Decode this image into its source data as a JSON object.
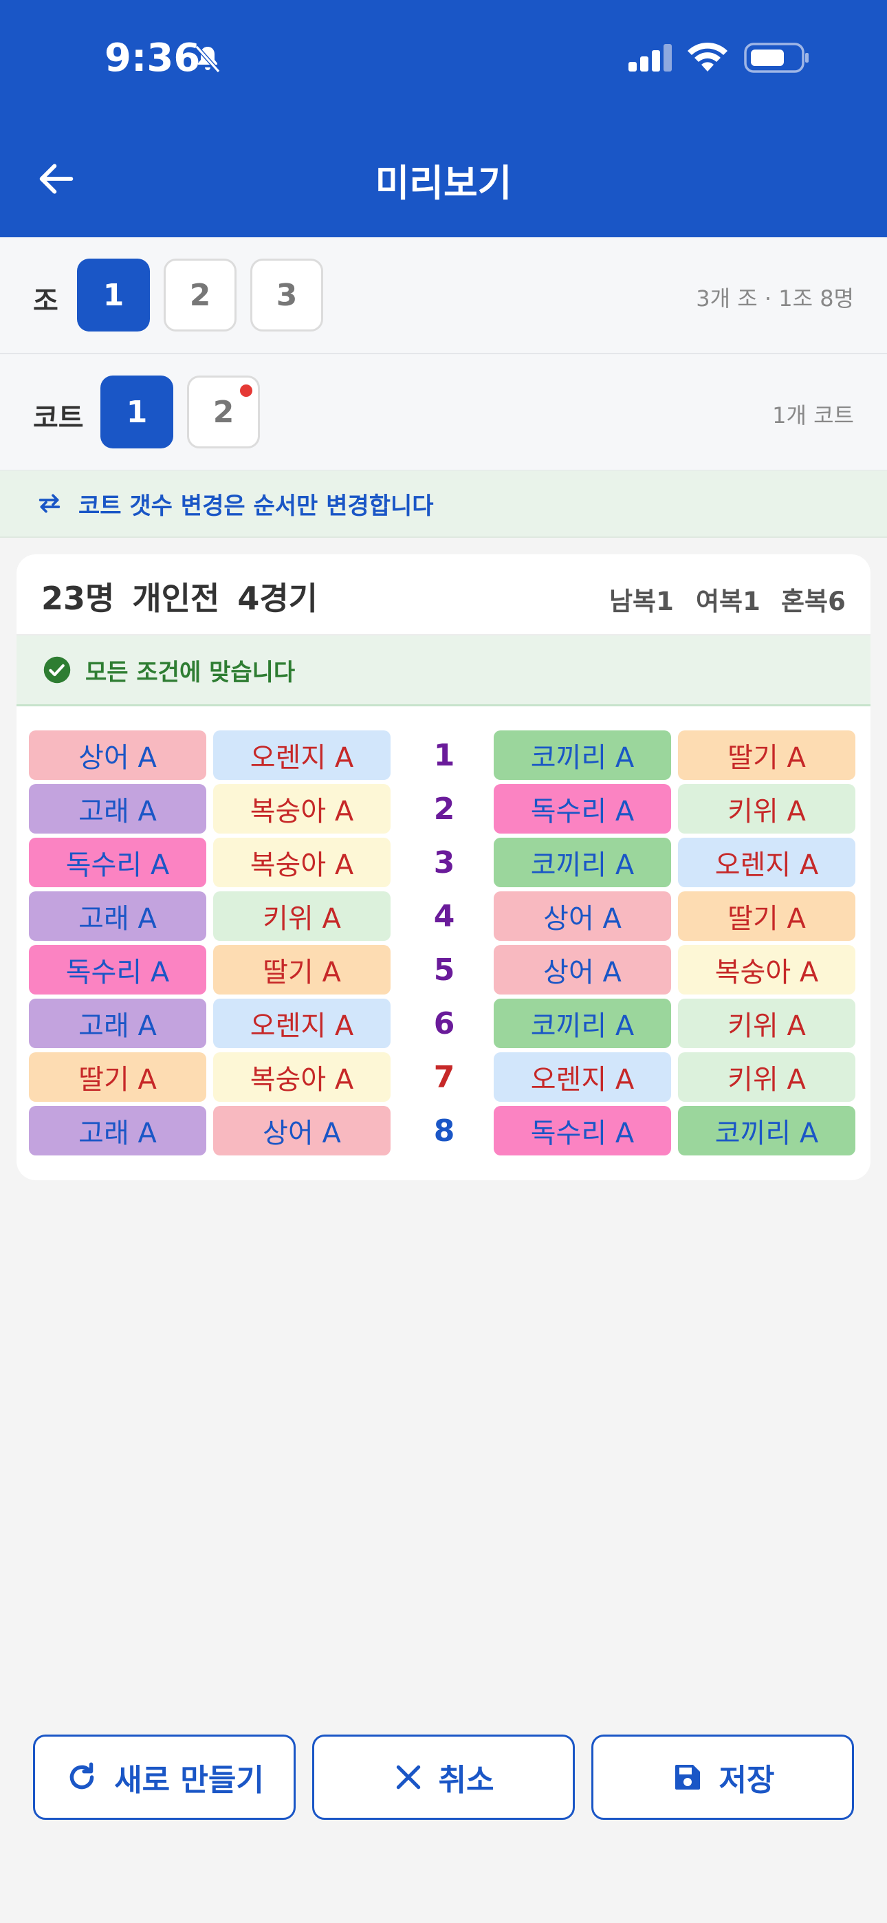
{
  "status_bar": {
    "time": "9:36"
  },
  "header": {
    "title": "미리보기"
  },
  "groups": {
    "label": "조",
    "options": [
      "1",
      "2",
      "3"
    ],
    "selected": "1",
    "info": "3개 조 · 1조 8명"
  },
  "courts": {
    "label": "코트",
    "options": [
      "1",
      "2"
    ],
    "selected": "1",
    "info": "1개 코트"
  },
  "notice": {
    "text": "코트 갯수 변경은 순서만 변경합니다"
  },
  "summary": {
    "title": "23명 개인전 4경기",
    "stats": [
      "남복1",
      "여복1",
      "혼복6"
    ],
    "status": "모든 조건에 맞습니다"
  },
  "colors": {
    "primary": "#1a56c6",
    "shark": "#f8b9c0",
    "orange": "#d2e6fb",
    "whale": "#c3a3de",
    "peach": "#fdf7d6",
    "eagle": "#fb83c2",
    "kiwi": "#dcf1dc",
    "elephant": "#9bd69c",
    "strawberry": "#fddcb2"
  },
  "matches": [
    {
      "no": "1",
      "num_color": "#6a1b9a",
      "left": [
        {
          "name": "상어 A",
          "bg": "#f8b9c0",
          "fg": "#1a56c6"
        },
        {
          "name": "오렌지 A",
          "bg": "#d2e6fb",
          "fg": "#c62828"
        }
      ],
      "right": [
        {
          "name": "코끼리 A",
          "bg": "#9bd69c",
          "fg": "#1a56c6"
        },
        {
          "name": "딸기 A",
          "bg": "#fddcb2",
          "fg": "#c62828"
        }
      ]
    },
    {
      "no": "2",
      "num_color": "#6a1b9a",
      "left": [
        {
          "name": "고래 A",
          "bg": "#c3a3de",
          "fg": "#1a56c6"
        },
        {
          "name": "복숭아 A",
          "bg": "#fdf7d6",
          "fg": "#c62828"
        }
      ],
      "right": [
        {
          "name": "독수리 A",
          "bg": "#fb83c2",
          "fg": "#1a56c6"
        },
        {
          "name": "키위 A",
          "bg": "#dcf1dc",
          "fg": "#c62828"
        }
      ]
    },
    {
      "no": "3",
      "num_color": "#6a1b9a",
      "left": [
        {
          "name": "독수리 A",
          "bg": "#fb83c2",
          "fg": "#1a56c6"
        },
        {
          "name": "복숭아 A",
          "bg": "#fdf7d6",
          "fg": "#c62828"
        }
      ],
      "right": [
        {
          "name": "코끼리 A",
          "bg": "#9bd69c",
          "fg": "#1a56c6"
        },
        {
          "name": "오렌지 A",
          "bg": "#d2e6fb",
          "fg": "#c62828"
        }
      ]
    },
    {
      "no": "4",
      "num_color": "#6a1b9a",
      "left": [
        {
          "name": "고래 A",
          "bg": "#c3a3de",
          "fg": "#1a56c6"
        },
        {
          "name": "키위 A",
          "bg": "#dcf1dc",
          "fg": "#c62828"
        }
      ],
      "right": [
        {
          "name": "상어 A",
          "bg": "#f8b9c0",
          "fg": "#1a56c6"
        },
        {
          "name": "딸기 A",
          "bg": "#fddcb2",
          "fg": "#c62828"
        }
      ]
    },
    {
      "no": "5",
      "num_color": "#6a1b9a",
      "left": [
        {
          "name": "독수리 A",
          "bg": "#fb83c2",
          "fg": "#1a56c6"
        },
        {
          "name": "딸기 A",
          "bg": "#fddcb2",
          "fg": "#c62828"
        }
      ],
      "right": [
        {
          "name": "상어 A",
          "bg": "#f8b9c0",
          "fg": "#1a56c6"
        },
        {
          "name": "복숭아 A",
          "bg": "#fdf7d6",
          "fg": "#c62828"
        }
      ]
    },
    {
      "no": "6",
      "num_color": "#6a1b9a",
      "left": [
        {
          "name": "고래 A",
          "bg": "#c3a3de",
          "fg": "#1a56c6"
        },
        {
          "name": "오렌지 A",
          "bg": "#d2e6fb",
          "fg": "#c62828"
        }
      ],
      "right": [
        {
          "name": "코끼리 A",
          "bg": "#9bd69c",
          "fg": "#1a56c6"
        },
        {
          "name": "키위 A",
          "bg": "#dcf1dc",
          "fg": "#c62828"
        }
      ]
    },
    {
      "no": "7",
      "num_color": "#c62828",
      "left": [
        {
          "name": "딸기 A",
          "bg": "#fddcb2",
          "fg": "#c62828"
        },
        {
          "name": "복숭아 A",
          "bg": "#fdf7d6",
          "fg": "#c62828"
        }
      ],
      "right": [
        {
          "name": "오렌지 A",
          "bg": "#d2e6fb",
          "fg": "#c62828"
        },
        {
          "name": "키위 A",
          "bg": "#dcf1dc",
          "fg": "#c62828"
        }
      ]
    },
    {
      "no": "8",
      "num_color": "#1a56c6",
      "left": [
        {
          "name": "고래 A",
          "bg": "#c3a3de",
          "fg": "#1a56c6"
        },
        {
          "name": "상어 A",
          "bg": "#f8b9c0",
          "fg": "#1a56c6"
        }
      ],
      "right": [
        {
          "name": "독수리 A",
          "bg": "#fb83c2",
          "fg": "#1a56c6"
        },
        {
          "name": "코끼리 A",
          "bg": "#9bd69c",
          "fg": "#1a56c6"
        }
      ]
    }
  ],
  "actions": {
    "regenerate": "새로 만들기",
    "cancel": "취소",
    "save": "저장"
  }
}
